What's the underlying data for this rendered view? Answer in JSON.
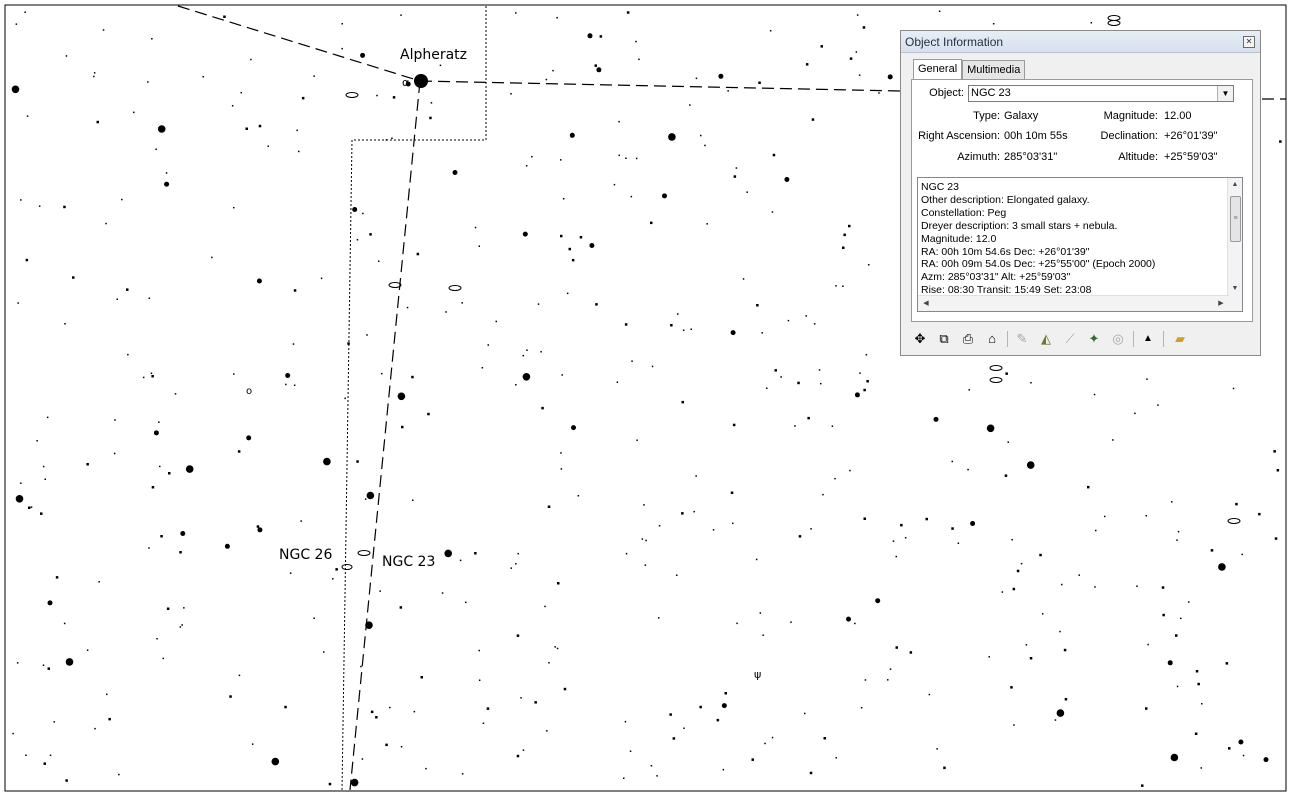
{
  "chart_labels": {
    "alpheratz": "Alpheratz",
    "ngc26": "NGC 26",
    "ngc23": "NGC 23"
  },
  "dialog": {
    "title": "Object Information",
    "tabs": [
      "General",
      "Multimedia"
    ],
    "object_label": "Object:",
    "object_value": "NGC 23",
    "fields": {
      "type_label": "Type:",
      "type_value": "Galaxy",
      "magnitude_label": "Magnitude:",
      "magnitude_value": "12.00",
      "ra_label": "Right Ascension:",
      "ra_value": "00h 10m 55s",
      "dec_label": "Declination:",
      "dec_value": "+26°01'39\"",
      "azimuth_label": "Azimuth:",
      "azimuth_value": "285°03'31\"",
      "altitude_label": "Altitude:",
      "altitude_value": "+25°59'03\""
    },
    "description_lines": [
      "NGC 23",
      "Other description: Elongated galaxy.",
      "Constellation:  Peg",
      "Dreyer description: 3 small stars + nebula.",
      "Magnitude: 12.0",
      "RA: 00h 10m 54.6s  Dec: +26°01'39\"",
      "RA: 00h 09m 54.0s  Dec: +25°55'00\"  (Epoch 2000)",
      "Azm: 285°03'31\"  Alt: +25°59'03\"",
      "Rise: 08:30  Transit: 15:49  Set: 23:08"
    ],
    "toolbar_icons": [
      "center-icon",
      "copy-icon",
      "print-icon",
      "book-icon",
      "pencil-icon",
      "chart-icon",
      "telescope-icon",
      "satellite-icon",
      "galaxy-icon",
      "up-icon",
      "folder-icon"
    ]
  }
}
